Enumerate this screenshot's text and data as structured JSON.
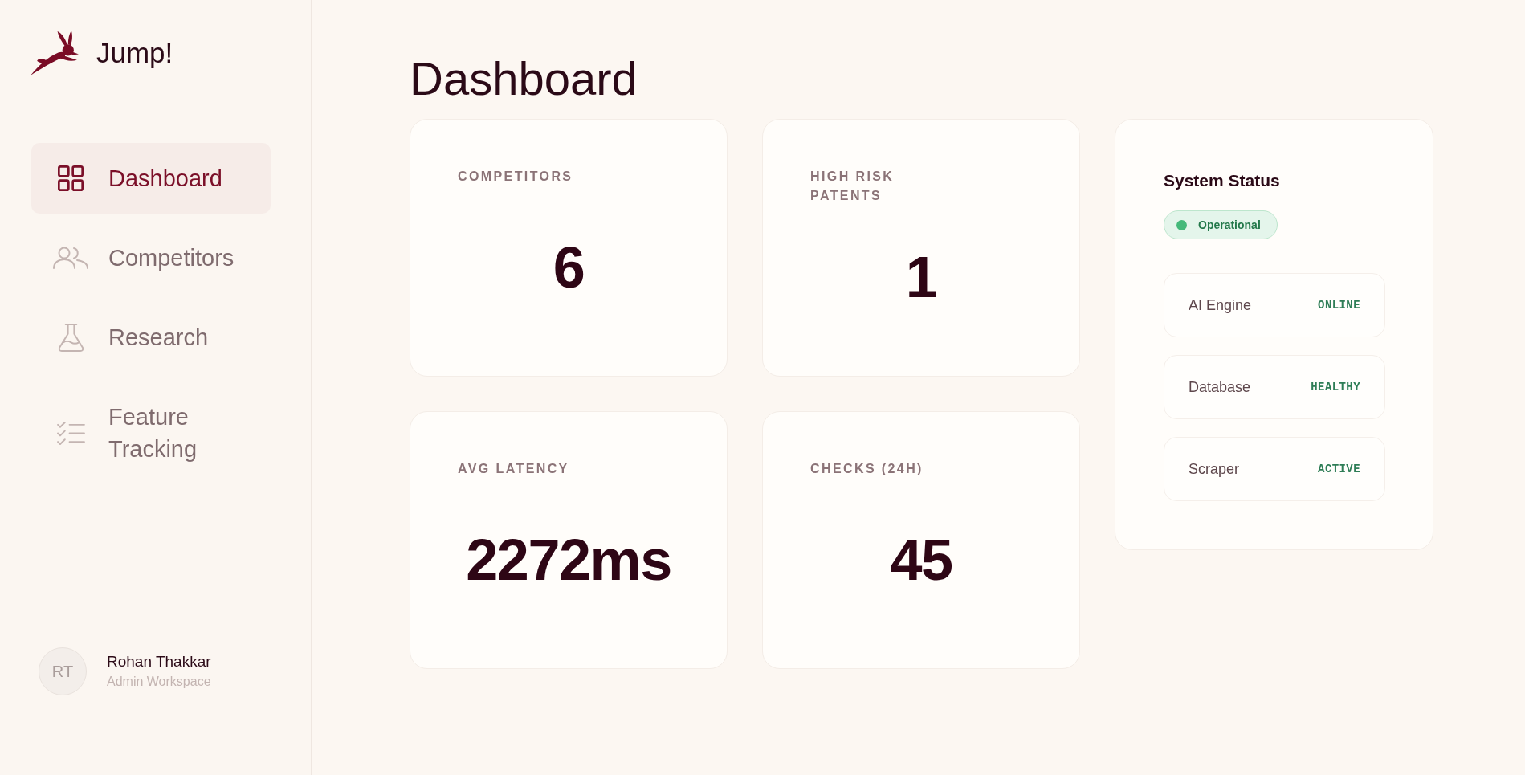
{
  "sidebar": {
    "brand": "Jump!",
    "nav_items": [
      {
        "label": "Dashboard",
        "selected": true
      },
      {
        "label": "Competitors",
        "selected": false
      },
      {
        "label": "Research",
        "selected": false
      },
      {
        "label": "Feature Tracking",
        "selected": false
      }
    ],
    "user": {
      "initials": "RT",
      "name": "Rohan Thakkar",
      "role": "Admin Workspace"
    }
  },
  "page": {
    "title": "Dashboard"
  },
  "stat_cards": [
    {
      "label": "COMPETITORS",
      "value": "6"
    },
    {
      "label": "HIGH RISK PATENTS",
      "value": "1"
    },
    {
      "label": "AVG LATENCY",
      "value": "2272ms"
    },
    {
      "label": "CHECKS (24H)",
      "value": "45"
    }
  ],
  "system_status": {
    "title": "System Status",
    "badge": "Operational",
    "services": [
      {
        "name": "AI Engine",
        "status": "ONLINE"
      },
      {
        "name": "Database",
        "status": "HEALTHY"
      },
      {
        "name": "Scraper",
        "status": "ACTIVE"
      }
    ]
  }
}
